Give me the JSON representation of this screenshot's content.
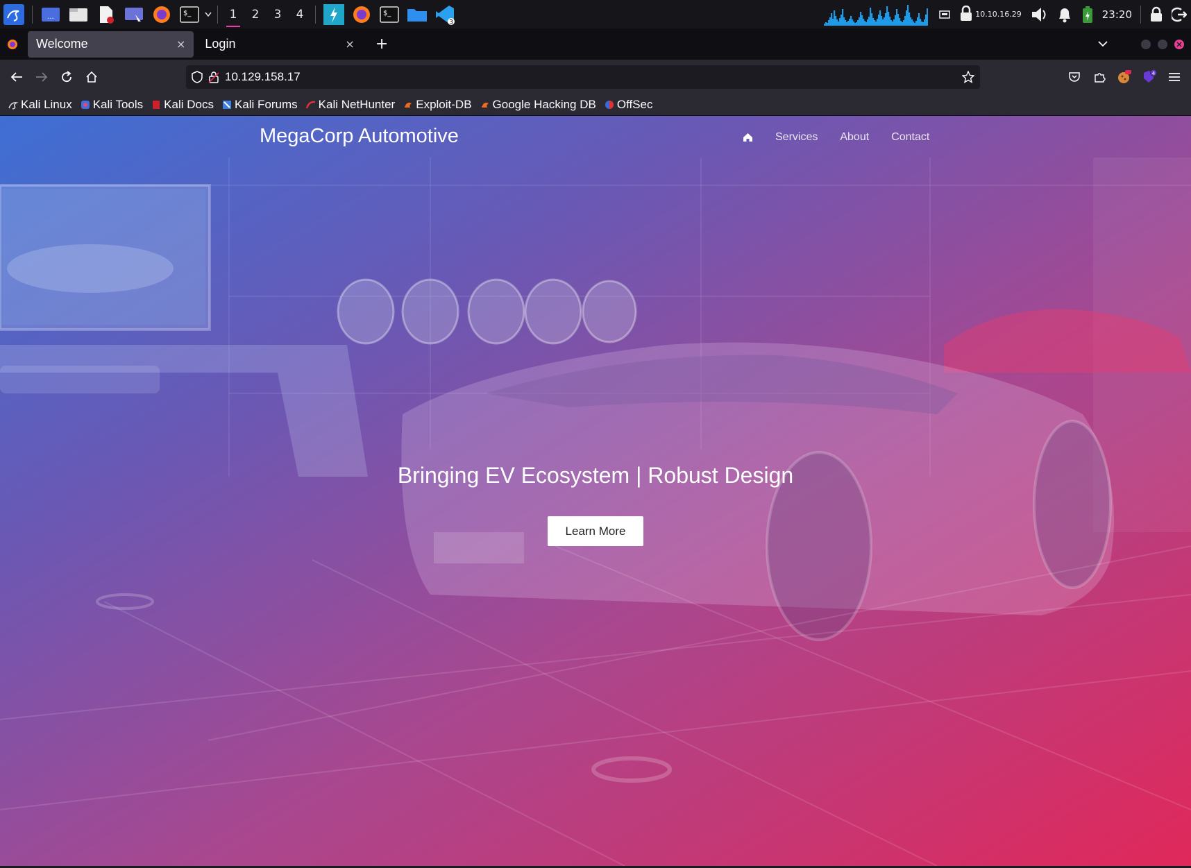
{
  "panel": {
    "workspaces": [
      "1",
      "2",
      "3",
      "4"
    ],
    "active_workspace": "1",
    "ip_address": "10.10.16.29",
    "clock": "23:20",
    "vscode_badge": "3",
    "accent_color": "#e83fa6"
  },
  "browser": {
    "tabs": [
      {
        "title": "Welcome",
        "close": "×"
      },
      {
        "title": "Login",
        "close": "×"
      }
    ],
    "new_tab": "+",
    "url": "10.129.158.17",
    "extension_badge": "4",
    "bookmarks": [
      {
        "label": "Kali Linux",
        "icon": "kali-dragon-icon"
      },
      {
        "label": "Kali Tools",
        "icon": "kali-tools-icon"
      },
      {
        "label": "Kali Docs",
        "icon": "kali-docs-icon"
      },
      {
        "label": "Kali Forums",
        "icon": "kali-forums-icon"
      },
      {
        "label": "Kali NetHunter",
        "icon": "nethunter-icon"
      },
      {
        "label": "Exploit-DB",
        "icon": "exploit-db-icon"
      },
      {
        "label": "Google Hacking DB",
        "icon": "ghdb-icon"
      },
      {
        "label": "OffSec",
        "icon": "offsec-icon"
      }
    ]
  },
  "site": {
    "brand": "MegaCorp Automotive",
    "nav": [
      "Services",
      "About",
      "Contact"
    ],
    "hero_heading": "Bringing EV Ecosystem | Robust Design",
    "cta_label": "Learn More",
    "gradient_colors": [
      "#3e6fd4",
      "#6a58b4",
      "#a9478f",
      "#e0285a"
    ]
  }
}
